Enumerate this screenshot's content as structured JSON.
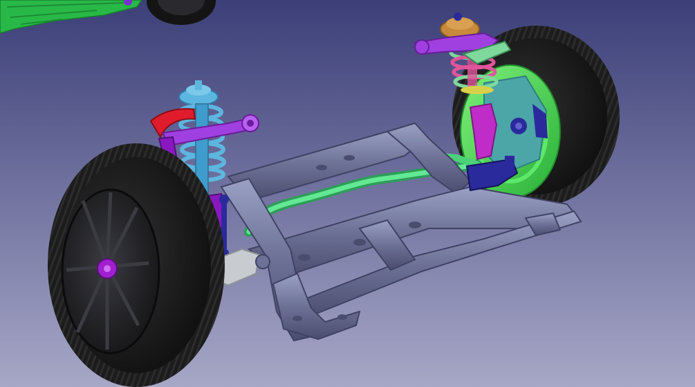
{
  "app": {
    "view": "3d-viewport",
    "background": {
      "top": "#3c3f78",
      "bottom": "#a7a7c7"
    }
  },
  "scene": {
    "colors": {
      "subframe": "#6d7196",
      "subframe_highlight": "#9aa0c4",
      "subframe_shadow": "#4a4d6e",
      "tire": "#1a1a1a",
      "tire_tread": "#2b2b2b",
      "rim": "#262629",
      "spring_blue": "#5db6df",
      "strut_blue": "#3f9ccc",
      "spring_pink": "#e0559a",
      "spring_green": "#7fd89c",
      "top_mount_orange": "#c68a3a",
      "hub_green": "#44dd55",
      "stabilizer_green": "#4cd07a",
      "control_arm_purple": "#a040e0",
      "knuckle_magenta": "#c02cc8",
      "upper_arm_red": "#e01c2c",
      "link_navy": "#2a2a9c",
      "bracket_grey": "#c8ccd0",
      "body_green": "#28b848"
    }
  }
}
